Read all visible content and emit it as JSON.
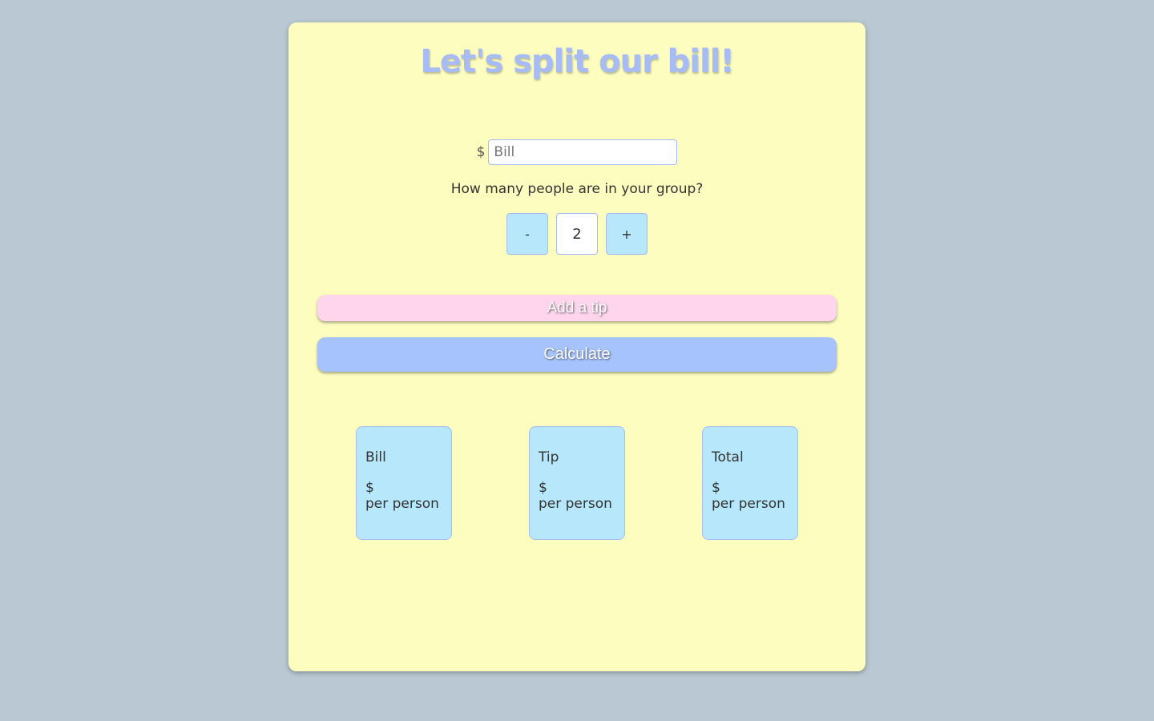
{
  "title": "Let's split our bill!",
  "bill": {
    "currency": "$",
    "placeholder": "Bill",
    "value": ""
  },
  "people": {
    "question": "How many people are in your group?",
    "minus": "-",
    "count": "2",
    "plus": "+"
  },
  "buttons": {
    "tip": "Add a tip",
    "calculate": "Calculate"
  },
  "results": [
    {
      "label": "Bill",
      "currency": "$",
      "unit": "per person"
    },
    {
      "label": "Tip",
      "currency": "$",
      "unit": "per person"
    },
    {
      "label": "Total",
      "currency": "$",
      "unit": "per person"
    }
  ]
}
